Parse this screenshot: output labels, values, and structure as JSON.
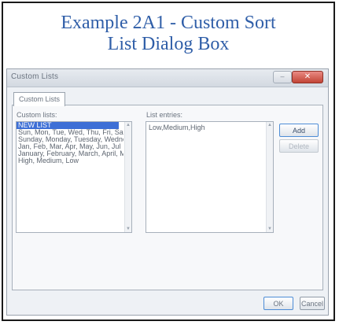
{
  "caption": {
    "line1": "Example 2A1 - Custom Sort",
    "line2": "List Dialog Box"
  },
  "dialog": {
    "title": "Custom Lists",
    "close_label": "✕",
    "min_label": "–",
    "tab_label": "Custom Lists",
    "custom_lists_label": "Custom lists:",
    "custom_lists": [
      "NEW LIST",
      "Sun, Mon, Tue, Wed, Thu, Fri, Sat",
      "Sunday, Monday, Tuesday, Wednesday",
      "Jan, Feb, Mar, Apr, May, Jun, Jul",
      "January, February, March, April, May",
      "High, Medium, Low"
    ],
    "list_entries_label": "List entries:",
    "list_entries_value": "Low,Medium,High",
    "add_label": "Add",
    "delete_label": "Delete",
    "ok_label": "OK",
    "cancel_label": "Cancel"
  }
}
